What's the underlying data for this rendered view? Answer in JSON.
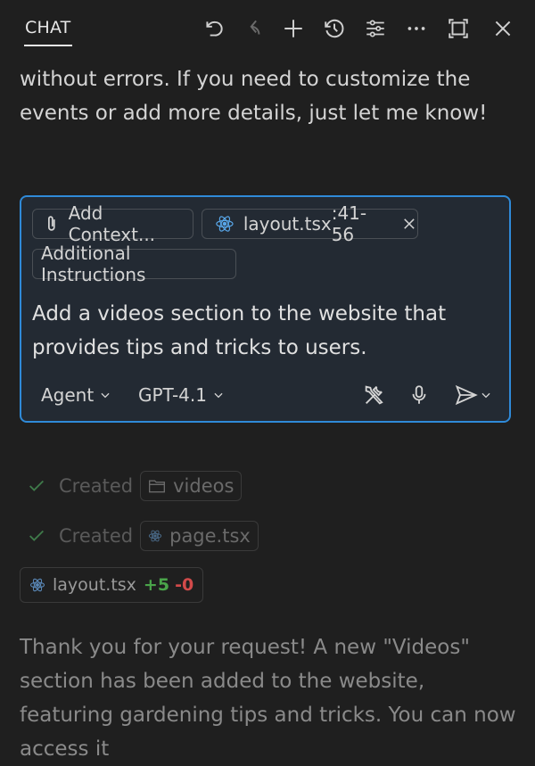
{
  "header": {
    "tab_label": "CHAT",
    "icons": [
      "undo-icon",
      "redo-icon",
      "plus-icon",
      "history-icon",
      "settings-sliders-icon",
      "more-icon",
      "maximize-icon",
      "close-icon"
    ]
  },
  "messages": {
    "top_text": "without errors. If you need to customize the events or add more details, just let me know!",
    "bottom_text": "Thank you for your request! A new \"Videos\" section has been added to the website, featuring gardening tips and tricks. You can now access it"
  },
  "input": {
    "add_context_label": "Add Context...",
    "file_chip": {
      "name": "layout.tsx",
      "range": ":41-56"
    },
    "additional_instructions_label": "Additional Instructions",
    "prompt_text": "Add a videos section to the website that provides tips and tricks to users.",
    "mode_label": "Agent",
    "model_label": "GPT-4.1"
  },
  "steps": [
    {
      "status": "Created",
      "file": "videos",
      "icon": "folder-icon"
    },
    {
      "status": "Created",
      "file": "page.tsx",
      "icon": "react-icon"
    }
  ],
  "changed_file": {
    "name": "layout.tsx",
    "added": "+5",
    "removed": "-0"
  },
  "colors": {
    "accent": "#2f8ad8",
    "added": "#4aa44a",
    "removed": "#d24a4a",
    "check": "#3f8f4f"
  }
}
